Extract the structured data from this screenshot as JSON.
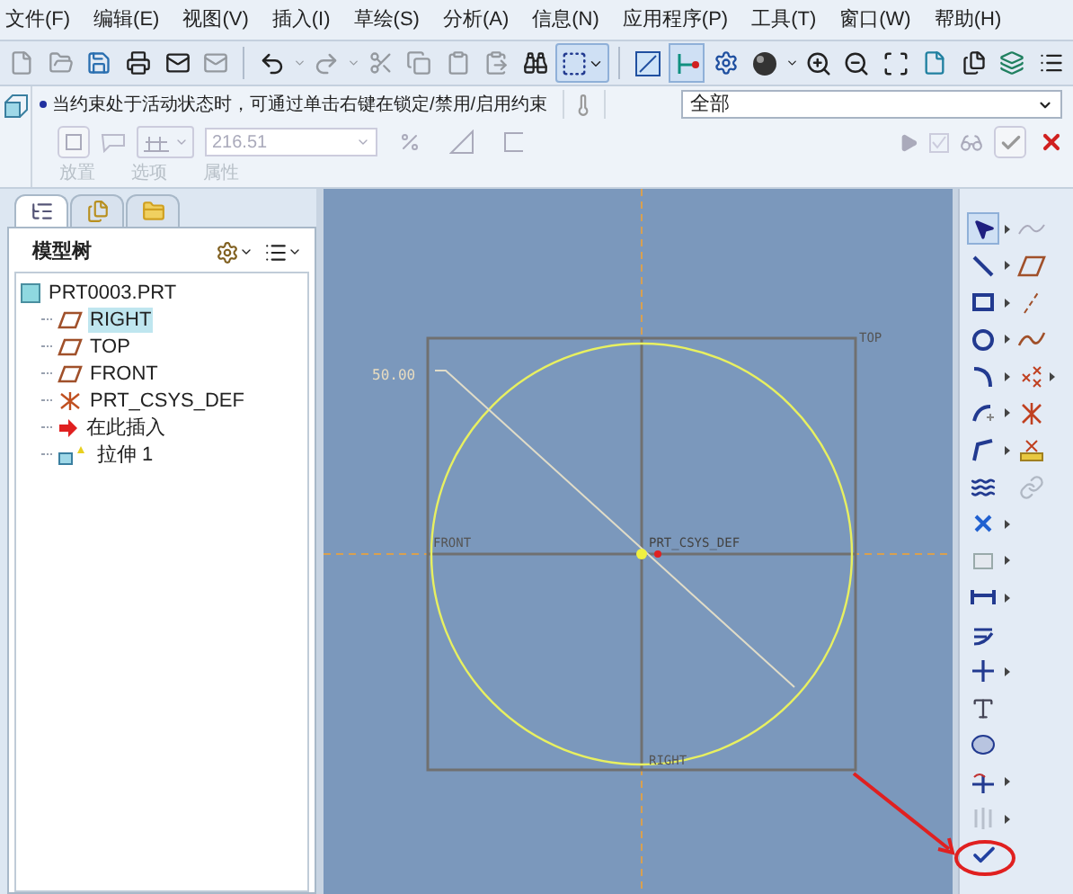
{
  "menu": [
    "文件(F)",
    "编辑(E)",
    "视图(V)",
    "插入(I)",
    "草绘(S)",
    "分析(A)",
    "信息(N)",
    "应用程序(P)",
    "工具(T)",
    "窗口(W)",
    "帮助(H)"
  ],
  "dashboard": {
    "message": "当约束处于活动状态时，可通过单击右键在锁定/禁用/启用约束",
    "filter": "全部",
    "depth_value": "216.51",
    "tabs": [
      {
        "label": "放置",
        "disabled": true
      },
      {
        "label": "选项",
        "disabled": true
      },
      {
        "label": "属性",
        "disabled": true
      }
    ]
  },
  "panel_tabs": [
    {
      "kind": "tree",
      "selected": true
    },
    {
      "kind": "layers",
      "selected": false
    },
    {
      "kind": "folder",
      "selected": false
    }
  ],
  "model_tree": {
    "title": "模型树",
    "items": [
      {
        "label": "PRT0003.PRT",
        "kind": "part",
        "selected": false,
        "children": [
          {
            "label": "RIGHT",
            "kind": "plane",
            "selected": true
          },
          {
            "label": "TOP",
            "kind": "plane",
            "selected": false
          },
          {
            "label": "FRONT",
            "kind": "plane",
            "selected": false
          },
          {
            "label": "PRT_CSYS_DEF",
            "kind": "csys",
            "selected": false
          },
          {
            "label": "在此插入",
            "kind": "insert",
            "selected": false
          },
          {
            "label": "拉伸 1",
            "kind": "extrude",
            "selected": false
          }
        ]
      }
    ]
  },
  "sketch": {
    "dimension": "50.00",
    "top_label": "TOP",
    "front_label": "FRONT",
    "csys_label": "PRT_CSYS_DEF",
    "right_label": "RIGHT"
  }
}
